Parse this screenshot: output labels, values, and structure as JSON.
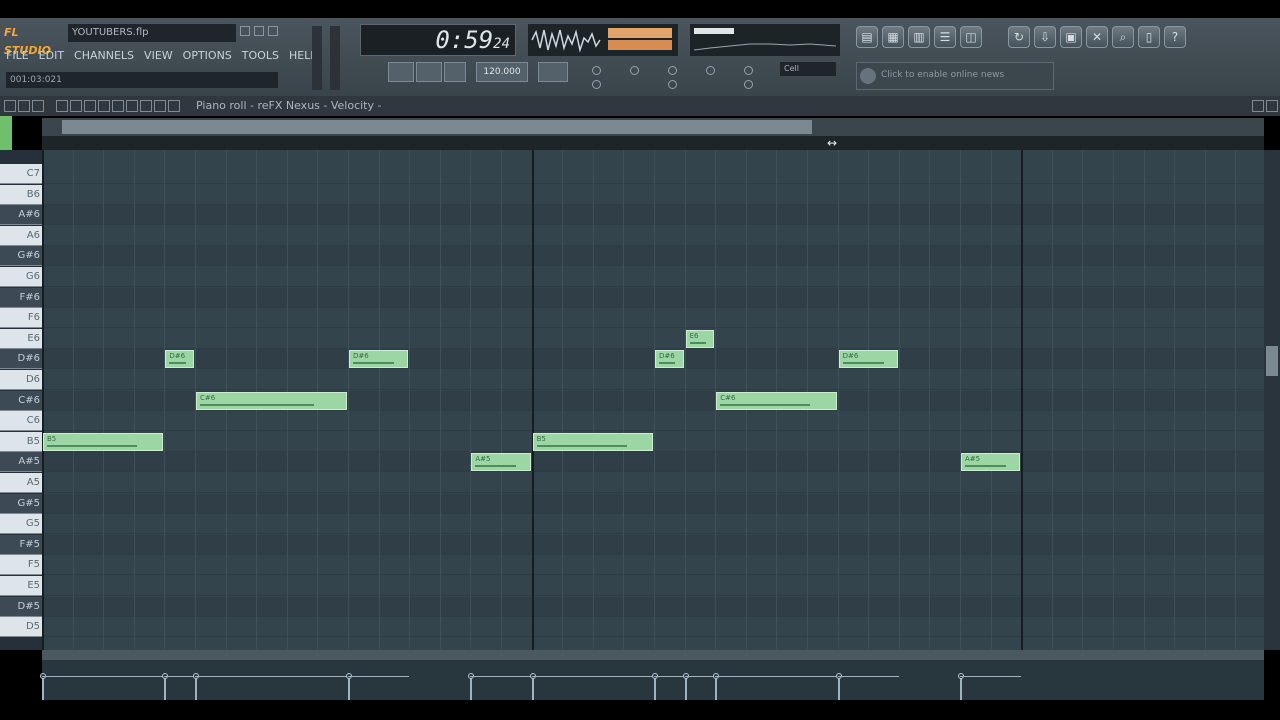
{
  "app": {
    "logo": "FL STUDIO",
    "filename": "YOUTUBERS.flp",
    "position": "001:03:021",
    "menu": [
      "FILE",
      "EDIT",
      "CHANNELS",
      "VIEW",
      "OPTIONS",
      "TOOLS",
      "HELP"
    ]
  },
  "transport": {
    "time": "0:59",
    "time_frac": "24",
    "tempo_label": "120.000",
    "snap_value": "Cell"
  },
  "news": {
    "label": "Click to enable online news"
  },
  "piano_roll": {
    "title": "Piano roll - reFX Nexus - Velocity -",
    "keys": [
      {
        "name": "C7",
        "type": "white"
      },
      {
        "name": "B6",
        "type": "white"
      },
      {
        "name": "A#6",
        "type": "black"
      },
      {
        "name": "A6",
        "type": "white"
      },
      {
        "name": "G#6",
        "type": "black"
      },
      {
        "name": "G6",
        "type": "white"
      },
      {
        "name": "F#6",
        "type": "black"
      },
      {
        "name": "F6",
        "type": "white"
      },
      {
        "name": "E6",
        "type": "white"
      },
      {
        "name": "D#6",
        "type": "black"
      },
      {
        "name": "D6",
        "type": "white"
      },
      {
        "name": "C#6",
        "type": "black"
      },
      {
        "name": "C6",
        "type": "white"
      },
      {
        "name": "B5",
        "type": "white"
      },
      {
        "name": "A#5",
        "type": "black"
      },
      {
        "name": "A5",
        "type": "white"
      },
      {
        "name": "G#5",
        "type": "black"
      },
      {
        "name": "G5",
        "type": "white"
      },
      {
        "name": "F#5",
        "type": "black"
      },
      {
        "name": "F5",
        "type": "white"
      },
      {
        "name": "E5",
        "type": "white"
      },
      {
        "name": "D#5",
        "type": "black"
      },
      {
        "name": "D5",
        "type": "white"
      }
    ],
    "notes": [
      {
        "pitch": "B5",
        "start": 0,
        "length": 4,
        "label": "B5"
      },
      {
        "pitch": "D#6",
        "start": 4,
        "length": 1,
        "label": "D#6"
      },
      {
        "pitch": "C#6",
        "start": 5,
        "length": 5,
        "label": "C#6"
      },
      {
        "pitch": "D#6",
        "start": 10,
        "length": 2,
        "label": "D#6"
      },
      {
        "pitch": "A#5",
        "start": 14,
        "length": 2,
        "label": "A#5"
      },
      {
        "pitch": "B5",
        "start": 16,
        "length": 4,
        "label": "B5"
      },
      {
        "pitch": "D#6",
        "start": 20,
        "length": 1,
        "label": "D#6"
      },
      {
        "pitch": "E6",
        "start": 21,
        "length": 1,
        "label": "E6"
      },
      {
        "pitch": "C#6",
        "start": 22,
        "length": 4,
        "label": "C#6"
      },
      {
        "pitch": "D#6",
        "start": 26,
        "length": 2,
        "label": "D#6"
      },
      {
        "pitch": "A#5",
        "start": 30,
        "length": 2,
        "label": "A#5"
      }
    ],
    "velocity": 0.8
  },
  "colors": {
    "note": "#9cd6a5",
    "note_border": "#cfeccf",
    "grid": "#34444d",
    "accent": "#f3a73b"
  }
}
